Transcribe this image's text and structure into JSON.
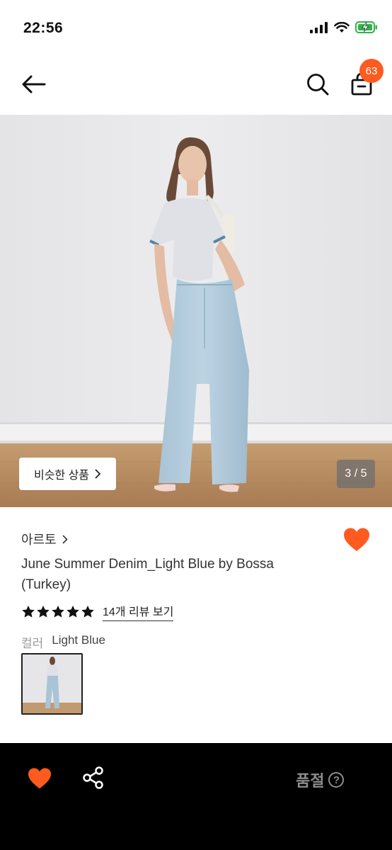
{
  "status_bar": {
    "time": "22:56"
  },
  "header": {
    "cart_count": "63"
  },
  "gallery": {
    "similar_label": "비슷한 상품",
    "counter": "3 / 5"
  },
  "product": {
    "brand": "아르토",
    "title": "June Summer Denim_Light Blue by Bossa (Turkey)",
    "rating_stars": 5,
    "review_link": "14개 리뷰 보기",
    "color_label": "컬러",
    "color_value": "Light Blue"
  },
  "bottom_bar": {
    "status": "품절"
  },
  "colors": {
    "accent": "#ff5a1f",
    "bar": "#000000",
    "muted": "#8c8c8c"
  },
  "icons": [
    "back-arrow-icon",
    "search-icon",
    "shopping-bag-icon",
    "chevron-right-icon",
    "heart-icon",
    "star-icon",
    "share-icon",
    "help-circle-icon"
  ]
}
